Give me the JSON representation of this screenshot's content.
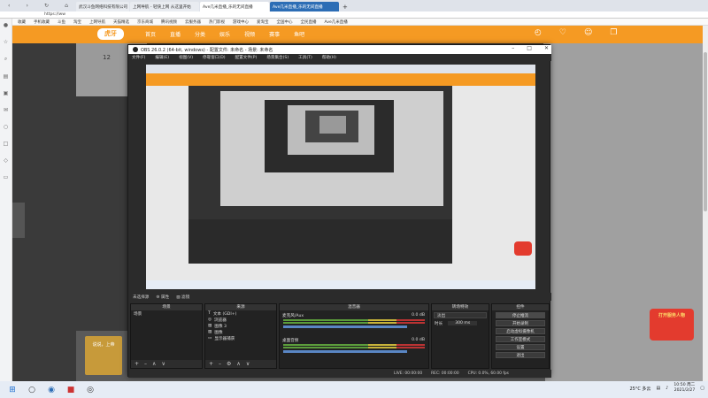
{
  "browser": {
    "tabs": [
      {
        "label": "武汉斗鱼网络科技有限公司",
        "state": "inactive"
      },
      {
        "label": "上网导航 - 轻快上网 从这里开始",
        "state": "inactive"
      },
      {
        "label": "Ave几米直播_乐的无间直播",
        "state": "active"
      },
      {
        "label": "Ave几米直播_乐的无间直播",
        "state": "dark"
      }
    ],
    "new_tab": "+",
    "url": "https://ww",
    "bookmarks": [
      "收藏",
      "手机收藏",
      "斗鱼",
      "淘宝",
      "上网导航",
      "天猫精选",
      "京东商城",
      "腾讯视频",
      "云服务器",
      "热门影视",
      "游戏中心",
      "爱淘宝",
      "全国中心",
      "全民直播",
      "Ave几米直播"
    ]
  },
  "huya": {
    "logo": "虎牙",
    "nav": [
      "首页",
      "直播",
      "分类",
      "娱乐",
      "视频",
      "赛事",
      "鱼吧"
    ],
    "fans_count": "12",
    "gift_banner": "说说，上帝",
    "promo": "打开服务人物"
  },
  "obs": {
    "title": "OBS 26.0.2 (64-bit, windows) - 配置文件: 未命名 - 场景: 未命名",
    "menu": [
      "文件(F)",
      "编辑(E)",
      "视图(V)",
      "停靠窗口(D)",
      "配置文件(P)",
      "场景集合(S)",
      "工具(T)",
      "帮助(H)"
    ],
    "source_bar": {
      "status": "未选择源",
      "props": "属性",
      "filters": "滤镜"
    },
    "docks": {
      "scenes": {
        "title": "场景",
        "items": [
          "场景"
        ]
      },
      "sources": {
        "title": "来源",
        "items": [
          "文本 (GDI+)",
          "浏览器",
          "图像 3",
          "图像",
          "显示器捕获"
        ]
      },
      "mixer": {
        "title": "混音器",
        "channels": [
          {
            "name": "麦克风/Aux",
            "db": "0.0 dB"
          },
          {
            "name": "桌面音频",
            "db": "0.0 dB"
          }
        ]
      },
      "transitions": {
        "title": "转场特效",
        "type": "淡出",
        "duration_label": "时长",
        "duration": "300 ms"
      },
      "controls": {
        "title": "控件",
        "buttons": [
          "停止推流",
          "开始录制",
          "启动虚拟摄像机",
          "工作室模式",
          "设置",
          "退出"
        ]
      }
    },
    "status": {
      "live": "LIVE: 00:00:00",
      "rec": "REC: 00:00:00",
      "cpu": "CPU: 0.0%, 60.00 fps"
    }
  },
  "taskbar": {
    "weather": "25°C 多云",
    "time": "10:50 周二",
    "date": "2021/2/27"
  }
}
